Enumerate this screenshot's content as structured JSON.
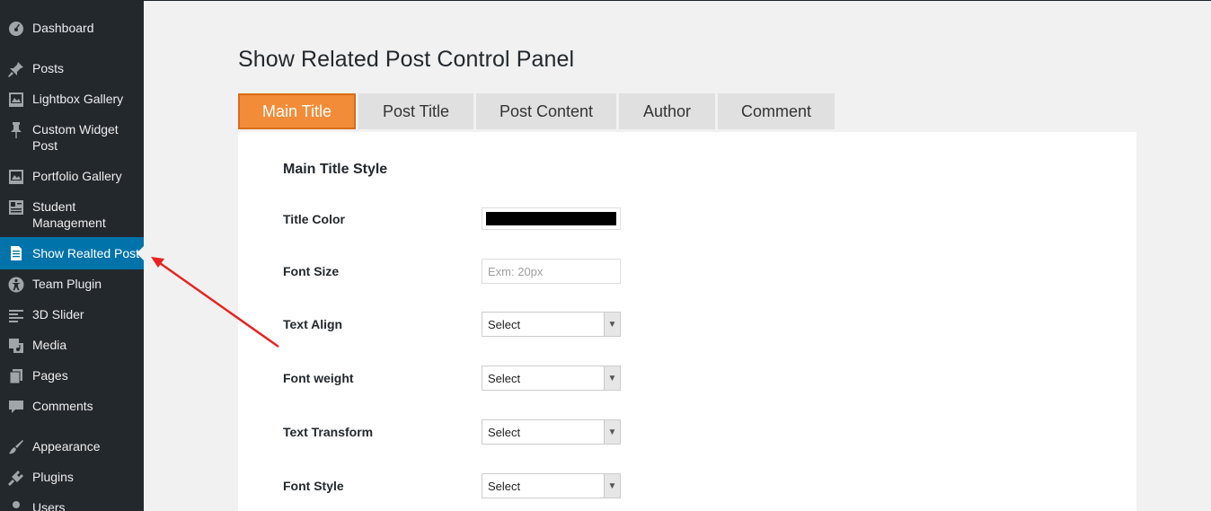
{
  "sidebar": {
    "items": [
      {
        "label": "Dashboard",
        "icon": "dashboard-icon"
      },
      {
        "label": "Posts",
        "icon": "pushpin-icon"
      },
      {
        "label": "Lightbox Gallery",
        "icon": "gallery-icon"
      },
      {
        "label": "Custom Widget Post",
        "icon": "pin-icon"
      },
      {
        "label": "Portfolio Gallery",
        "icon": "gallery-icon"
      },
      {
        "label": "Student Management",
        "icon": "id-card-icon"
      },
      {
        "label": "Show Realted Post",
        "icon": "document-icon",
        "active": true
      },
      {
        "label": "Team Plugin",
        "icon": "accessibility-icon"
      },
      {
        "label": "3D Slider",
        "icon": "list-icon"
      },
      {
        "label": "Media",
        "icon": "media-icon"
      },
      {
        "label": "Pages",
        "icon": "pages-icon"
      },
      {
        "label": "Comments",
        "icon": "comment-icon"
      },
      {
        "label": "Appearance",
        "icon": "paintbrush-icon"
      },
      {
        "label": "Plugins",
        "icon": "plug-icon"
      },
      {
        "label": "Users",
        "icon": "user-icon"
      }
    ]
  },
  "page": {
    "title": "Show Related Post Control Panel"
  },
  "tabs": [
    {
      "label": "Main Title",
      "active": true
    },
    {
      "label": "Post Title"
    },
    {
      "label": "Post Content"
    },
    {
      "label": "Author"
    },
    {
      "label": "Comment"
    }
  ],
  "form": {
    "section_title": "Main Title Style",
    "title_color": {
      "label": "Title Color",
      "value": "#000000"
    },
    "font_size": {
      "label": "Font Size",
      "placeholder": "Exm: 20px",
      "value": ""
    },
    "text_align": {
      "label": "Text Align",
      "selected": "Select"
    },
    "font_weight": {
      "label": "Font weight",
      "selected": "Select"
    },
    "text_transform": {
      "label": "Text Transform",
      "selected": "Select"
    },
    "font_style": {
      "label": "Font Style",
      "selected": "Select"
    }
  },
  "colors": {
    "sidebar_bg": "#23282d",
    "sidebar_active": "#0073aa",
    "tab_active": "#f28c38",
    "annotation_arrow": "#e8231f"
  }
}
